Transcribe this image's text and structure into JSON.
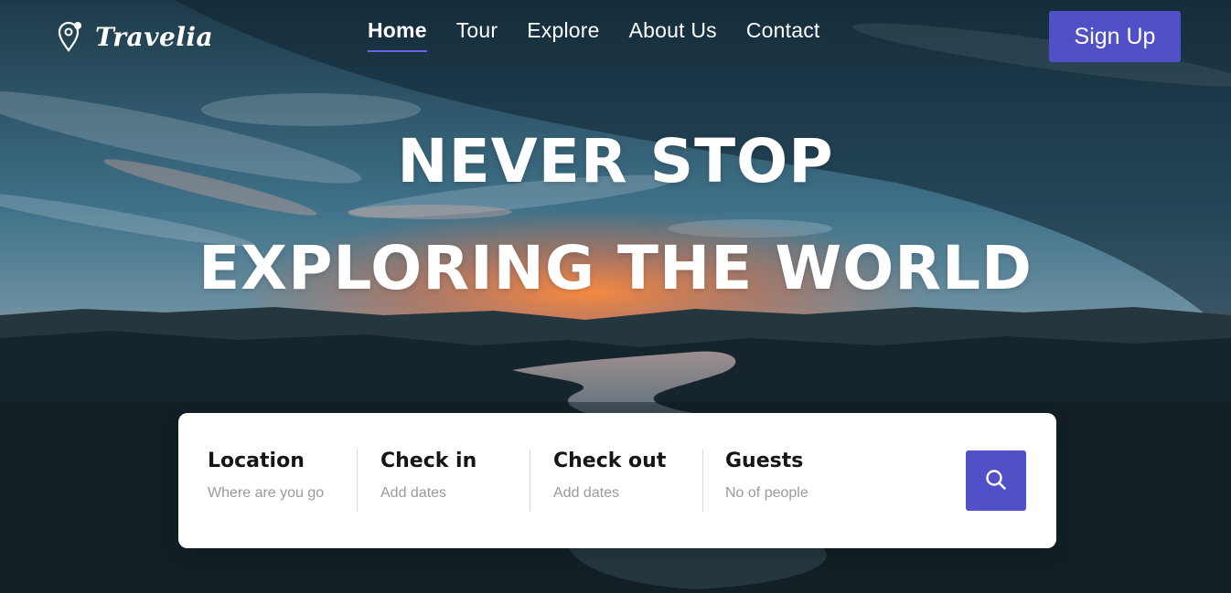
{
  "brand": {
    "name": "Travelia",
    "logo_icon": "map-pin-icon"
  },
  "nav": {
    "items": [
      {
        "label": "Home",
        "active": true
      },
      {
        "label": "Tour",
        "active": false
      },
      {
        "label": "Explore",
        "active": false
      },
      {
        "label": "About Us",
        "active": false
      },
      {
        "label": "Contact",
        "active": false
      }
    ],
    "signup_label": "Sign Up"
  },
  "hero": {
    "line1": "NEVER STOP",
    "line2": "EXPLORING THE WORLD"
  },
  "search": {
    "fields": [
      {
        "label": "Location",
        "placeholder": "Where are you go"
      },
      {
        "label": "Check in",
        "placeholder": "Add dates"
      },
      {
        "label": "Check out",
        "placeholder": "Add dates"
      },
      {
        "label": "Guests",
        "placeholder": "No of people"
      }
    ],
    "button_icon": "search-icon"
  },
  "colors": {
    "accent": "#5150c6",
    "active_underline": "#6b63e6",
    "text_light": "#ffffff"
  }
}
